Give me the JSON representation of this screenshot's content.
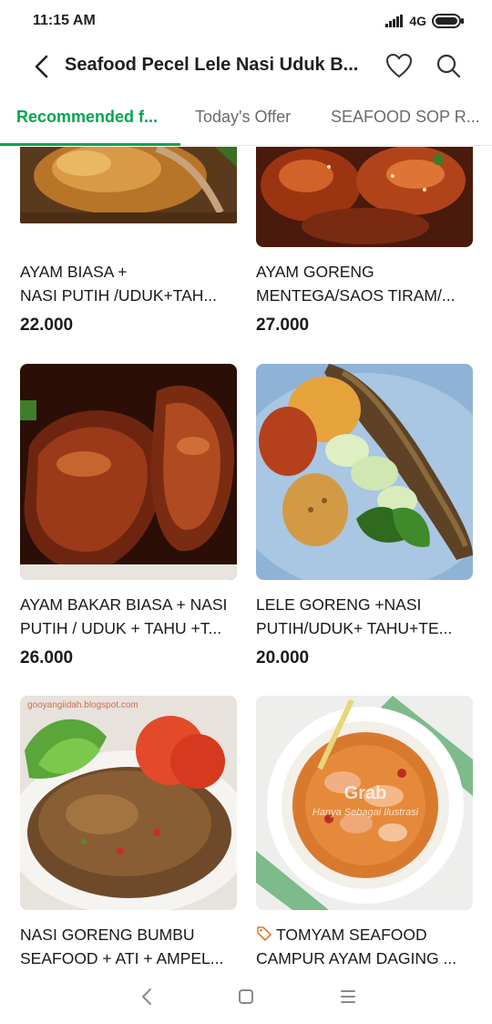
{
  "status": {
    "time": "11:15 AM",
    "network": "4G"
  },
  "header": {
    "title": "Seafood Pecel Lele Nasi Uduk B..."
  },
  "tabs": [
    {
      "label": "Recommended f...",
      "active": true
    },
    {
      "label": "Today's Offer",
      "active": false
    },
    {
      "label": "SEAFOOD SOP R...",
      "active": false
    }
  ],
  "menu_items": [
    {
      "line1": "AYAM BIASA +",
      "line2": "NASI PUTIH /UDUK+TAH...",
      "price": "22.000",
      "image": "fried-chicken"
    },
    {
      "line1": "AYAM  GORENG",
      "line2": "MENTEGA/SAOS TIRAM/...",
      "price": "27.000",
      "image": "glazed-wings"
    },
    {
      "line1": "AYAM BAKAR BIASA + NASI",
      "line2": "PUTIH / UDUK + TAHU +T...",
      "price": "26.000",
      "image": "grilled-chicken"
    },
    {
      "line1": "LELE GORENG +NASI",
      "line2": "PUTIH/UDUK+ TAHU+TE...",
      "price": "20.000",
      "image": "fried-catfish-plate"
    },
    {
      "line1": "NASI GORENG BUMBU",
      "line2": "SEAFOOD + ATI + AMPEL...",
      "price": "",
      "image": "fried-rice",
      "watermark": "gooyangiidah.blogspot.com"
    },
    {
      "line1": "TOMYAM SEAFOOD",
      "line2": "CAMPUR AYAM DAGING ...",
      "price": "",
      "image": "tomyam-soup",
      "promo_tag": true,
      "watermark": "Grab",
      "watermark_caption": "Hanya Sebagai Ilustrasi"
    }
  ],
  "colors": {
    "accent": "#00a651",
    "text": "#1a1a1a",
    "muted": "#6b6b6b"
  },
  "icons": [
    "back-arrow-icon",
    "heart-icon",
    "search-icon",
    "promo-tag-icon",
    "nav-back-icon",
    "nav-home-icon",
    "nav-menu-icon"
  ]
}
